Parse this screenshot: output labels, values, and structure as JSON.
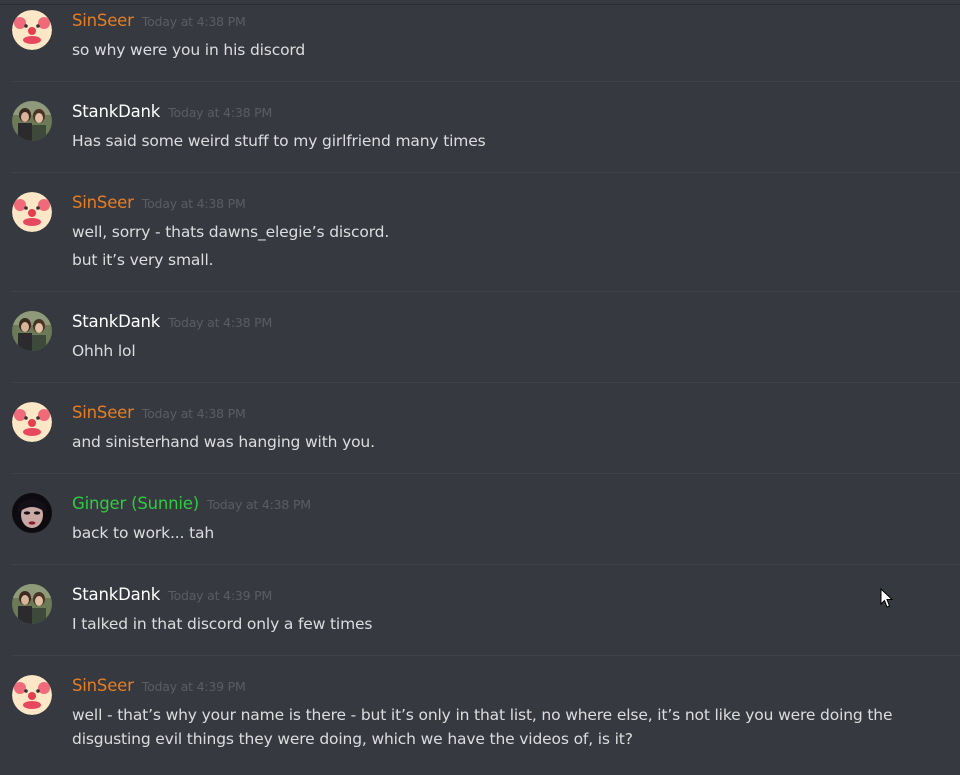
{
  "colors": {
    "background": "#36393f",
    "sinseer": "#e67e22",
    "stankdank": "#ffffff",
    "ginger": "#2ecc40",
    "timestamp": "#5a5d63",
    "message_text": "#dcddde"
  },
  "messages": [
    {
      "author": "SinSeer",
      "avatar_icon": "clown-avatar-icon",
      "timestamp": "Today at 4:38 PM",
      "lines": [
        "so why were you in his discord"
      ]
    },
    {
      "author": "StankDank",
      "avatar_icon": "photo-avatar-icon",
      "timestamp": "Today at 4:38 PM",
      "lines": [
        "Has said some weird stuff to my girlfriend many times"
      ]
    },
    {
      "author": "SinSeer",
      "avatar_icon": "clown-avatar-icon",
      "timestamp": "Today at 4:38 PM",
      "lines": [
        "well, sorry - thats dawns_elegie’s discord.",
        "but it’s very small."
      ]
    },
    {
      "author": "StankDank",
      "avatar_icon": "photo-avatar-icon",
      "timestamp": "Today at 4:38 PM",
      "lines": [
        "Ohhh lol"
      ]
    },
    {
      "author": "SinSeer",
      "avatar_icon": "clown-avatar-icon",
      "timestamp": "Today at 4:38 PM",
      "lines": [
        "and sinisterhand was hanging with you."
      ]
    },
    {
      "author": "Ginger (Sunnie)",
      "avatar_icon": "dark-portrait-avatar-icon",
      "timestamp": "Today at 4:38 PM",
      "lines": [
        "back to work... tah"
      ]
    },
    {
      "author": "StankDank",
      "avatar_icon": "photo-avatar-icon",
      "timestamp": "Today at 4:39 PM",
      "lines": [
        "I talked in that discord only a few times"
      ]
    },
    {
      "author": "SinSeer",
      "avatar_icon": "clown-avatar-icon",
      "timestamp": "Today at 4:39 PM",
      "lines": [
        "well - that’s why your name is there - but it’s only in that list, no where else, it’s not like  you were doing the",
        "disgusting evil things they were doing, which we have the videos of, is it?"
      ]
    }
  ]
}
